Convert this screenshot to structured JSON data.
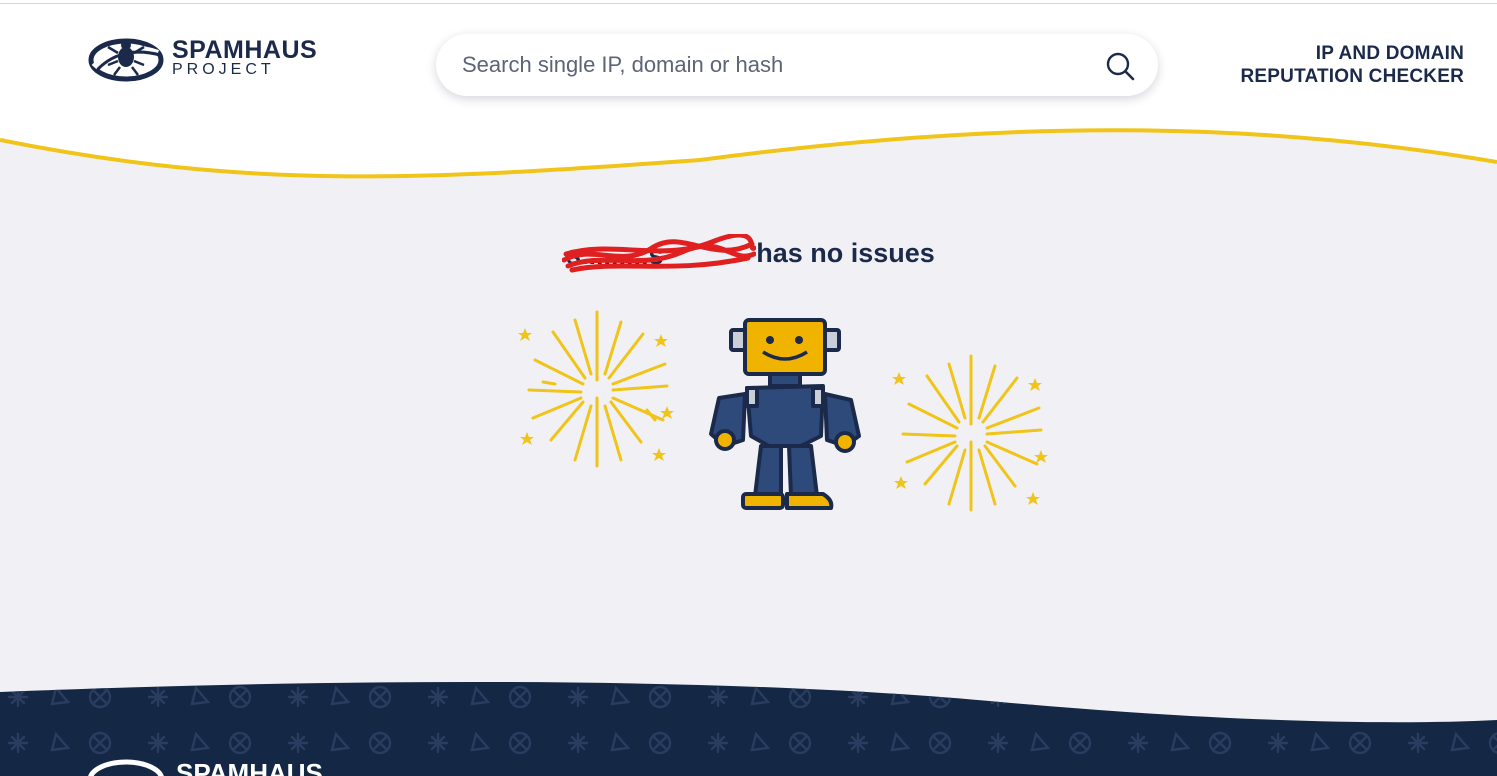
{
  "header": {
    "logo": {
      "name": "SPAMHAUS",
      "sub": "PROJECT"
    },
    "search": {
      "placeholder": "Search single IP, domain or hash"
    },
    "tagline_line1": "IP AND DOMAIN",
    "tagline_line2": "REPUTATION CHECKER"
  },
  "result": {
    "message": "has no issues",
    "redacted_subject": true
  },
  "footer": {
    "logo_name": "SPAMHAUS"
  },
  "colors": {
    "navy": "#1b2a4a",
    "accent_yellow": "#f0c419",
    "redaction_red": "#e02020",
    "background": "#f1f1f5"
  },
  "icons": [
    "spamhaus-logo-icon",
    "search-icon",
    "robot-illustration",
    "firework-icon"
  ]
}
